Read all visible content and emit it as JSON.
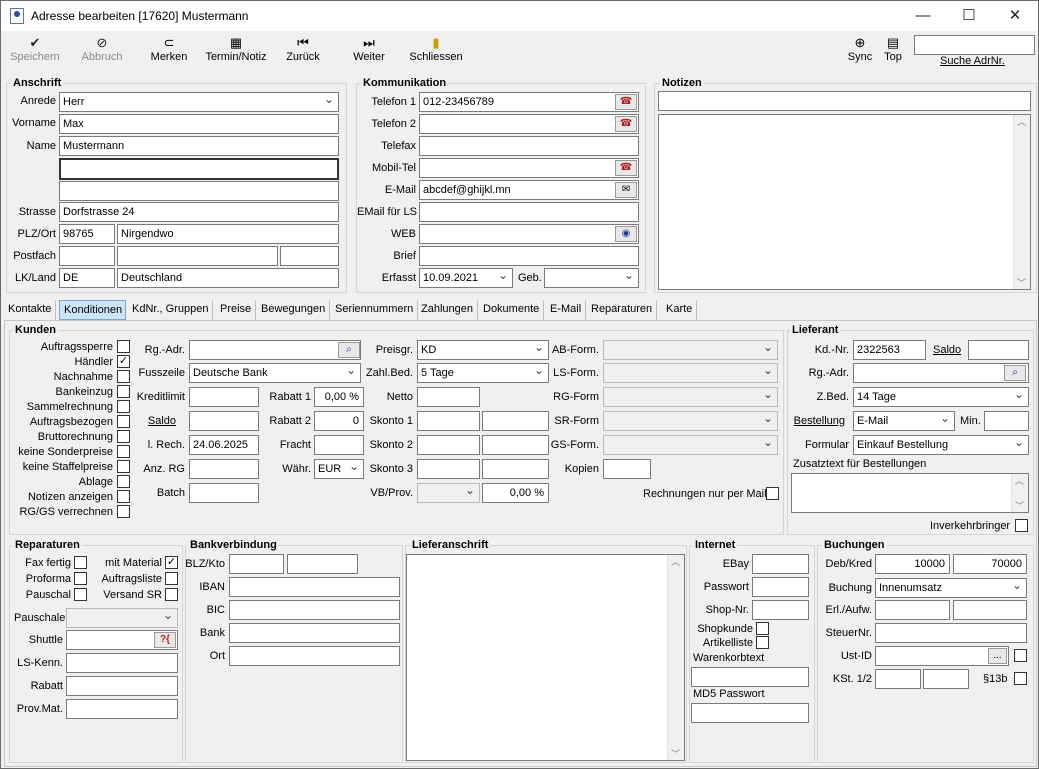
{
  "window": {
    "title": "Adresse bearbeiten [17620] Mustermann"
  },
  "toolbar": {
    "speichern": "Speichern",
    "abbruch": "Abbruch",
    "merken": "Merken",
    "termin": "Termin/Notiz",
    "zurueck": "Zurück",
    "weiter": "Weiter",
    "schliessen": "Schliessen",
    "sync": "Sync",
    "top": "Top",
    "suche_label": "Suche AdrNr.",
    "suche_value": ""
  },
  "anschrift": {
    "title": "Anschrift",
    "anrede_label": "Anrede",
    "anrede": "Herr",
    "vorname_label": "Vorname",
    "vorname": "Max",
    "name_label": "Name",
    "name": "Mustermann",
    "name2": "",
    "name3": "",
    "strasse_label": "Strasse",
    "strasse": "Dorfstrasse 24",
    "plzort_label": "PLZ/Ort",
    "plz": "98765",
    "ort": "Nirgendwo",
    "postfach_label": "Postfach",
    "lkland_label": "LK/Land",
    "lk": "DE",
    "land": "Deutschland"
  },
  "kommunikation": {
    "title": "Kommunikation",
    "telefon1_label": "Telefon 1",
    "telefon1": "012-23456789",
    "telefon2_label": "Telefon 2",
    "telefon2": "",
    "telefax_label": "Telefax",
    "mobil_label": "Mobil-Tel",
    "email_label": "E-Mail",
    "email": "abcdef@ghijkl.mn",
    "emaills_label": "EMail für LS",
    "web_label": "WEB",
    "brief_label": "Brief",
    "erfasst_label": "Erfasst",
    "erfasst": "10.09.2021",
    "geb_label": "Geb."
  },
  "notizen": {
    "title": "Notizen"
  },
  "tabs": [
    "Kontakte",
    "Konditionen",
    "KdNr., Gruppen",
    "Preise",
    "Bewegungen",
    "Seriennummern",
    "Zahlungen",
    "Dokumente",
    "E-Mail",
    "Reparaturen",
    "Karte"
  ],
  "kunden": {
    "title": "Kunden",
    "flags": [
      "Auftragssperre",
      "Händler",
      "Nachnahme",
      "Bankeinzug",
      "Sammelrechnung",
      "Auftragsbezogen",
      "Bruttorechnung",
      "keine Sonderpreise",
      "keine Staffelpreise",
      "Ablage",
      "Notizen anzeigen",
      "RG/GS verrechnen"
    ],
    "rgadr_label": "Rg.-Adr.",
    "fusszeile_label": "Fusszeile",
    "fusszeile": "Deutsche Bank",
    "kreditlimit_label": "Kreditlimit",
    "saldo_label": "Saldo",
    "lrech_label": "l. Rech.",
    "lrech": "24.06.2025",
    "anzrg_label": "Anz. RG",
    "batch_label": "Batch",
    "rabatt1_label": "Rabatt 1",
    "rabatt1": "0,00 %",
    "rabatt2_label": "Rabatt 2",
    "rabatt2": "0",
    "fracht_label": "Fracht",
    "waehr_label": "Währ.",
    "waehr": "EUR",
    "preisgr_label": "Preisgr.",
    "preisgr": "KD",
    "zahlbed_label": "Zahl.Bed.",
    "zahlbed": "5 Tage",
    "netto_label": "Netto",
    "skonto1_label": "Skonto 1",
    "skonto2_label": "Skonto 2",
    "skonto3_label": "Skonto 3",
    "vbprov_label": "VB/Prov.",
    "vbprov_value": "0,00 %",
    "abform_label": "AB-Form.",
    "lsform_label": "LS-Form.",
    "rgform_label": "RG-Form",
    "srform_label": "SR-Form",
    "gsform_label": "GS-Form.",
    "kopien_label": "Kopien",
    "rgmail_label": "Rechnungen nur per Mail"
  },
  "lieferant": {
    "title": "Lieferant",
    "kdnr_label": "Kd.-Nr.",
    "kdnr": "2322563",
    "saldo_label": "Saldo",
    "rgadr_label": "Rg.-Adr.",
    "zbed_label": "Z.Bed.",
    "zbed": "14 Tage",
    "bestellung_label": "Bestellung",
    "bestellung": "E-Mail",
    "min_label": "Min.",
    "formular_label": "Formular",
    "formular": "Einkauf Bestellung",
    "zusatz_label": "Zusatztext für Bestellungen",
    "inverkehr_label": "Inverkehrbringer"
  },
  "reparaturen": {
    "title": "Reparaturen",
    "faxfertig": "Fax fertig",
    "mitmaterial": "mit Material",
    "proforma": "Proforma",
    "auftragsliste": "Auftragsliste",
    "pauschal": "Pauschal",
    "versandsr": "Versand SR",
    "pauschale_label": "Pauschale",
    "shuttle_label": "Shuttle",
    "lskenn_label": "LS-Kenn.",
    "rabatt_label": "Rabatt",
    "provmat_label": "Prov.Mat."
  },
  "bank": {
    "title": "Bankverbindung",
    "blzkto_label": "BLZ/Kto",
    "iban_label": "IBAN",
    "bic_label": "BIC",
    "bank_label": "Bank",
    "ort_label": "Ort"
  },
  "lieferanschrift": {
    "title": "Lieferanschrift"
  },
  "internet": {
    "title": "Internet",
    "ebay_label": "EBay",
    "passwort_label": "Passwort",
    "shopnr_label": "Shop-Nr.",
    "shopkunde_label": "Shopkunde",
    "artikelliste_label": "Artikelliste",
    "warenkorb_label": "Warenkorbtext",
    "md5_label": "MD5 Passwort"
  },
  "buchungen": {
    "title": "Buchungen",
    "debkred_label": "Deb/Kred",
    "deb": "10000",
    "kred": "70000",
    "buchung_label": "Buchung",
    "buchung": "Innenumsatz",
    "erlaufw_label": "Erl./Aufw.",
    "steuernr_label": "SteuerNr.",
    "ustid_label": "Ust-ID",
    "ustid_btn": "...",
    "kst_label": "KSt. 1/2",
    "s13b_label": "§13b"
  }
}
